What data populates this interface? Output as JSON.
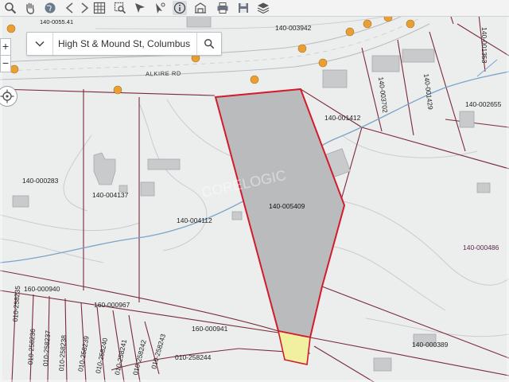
{
  "search": {
    "value": "High St & Mound St, Columbus",
    "placeholder": "High St & Mound St, Columbus"
  },
  "toolbar": {
    "tools": [
      {
        "name": "zoom-tool",
        "icon": "magnifier-icon"
      },
      {
        "name": "pan-tool",
        "icon": "hand-icon"
      },
      {
        "name": "full-extent-tool",
        "icon": "globe-icon"
      },
      {
        "name": "previous-extent-tool",
        "icon": "back-arrow-icon"
      },
      {
        "name": "next-extent-tool",
        "icon": "forward-arrow-icon"
      },
      {
        "name": "select-tool",
        "icon": "grid-select-icon"
      },
      {
        "name": "zoom-box-tool",
        "icon": "box-zoom-icon"
      },
      {
        "name": "locate-tool",
        "icon": "pointer-icon"
      },
      {
        "name": "measure-tool",
        "icon": "arrow-pointer-icon"
      },
      {
        "name": "identify-tool",
        "icon": "info-icon"
      },
      {
        "name": "property-tool",
        "icon": "building-icon"
      },
      {
        "name": "print-tool",
        "icon": "printer-icon"
      },
      {
        "name": "export-tool",
        "icon": "save-icon"
      },
      {
        "name": "layers-tool",
        "icon": "layers-icon"
      }
    ]
  },
  "zoom": {
    "in": "+",
    "out": "−"
  },
  "road": {
    "name": "ALKIRE RD"
  },
  "parcels": {
    "selected": "140-005409",
    "labels": [
      "140-003942",
      "140-000283",
      "140-004137",
      "140-004112",
      "140-001412",
      "140-002655",
      "140-003702",
      "140-001429",
      "140-001353",
      "140-000486",
      "160-000940",
      "160-000967",
      "160-000941",
      "140-000389",
      "010-258244",
      "010-258235",
      "010-258236",
      "010-258237",
      "010-258238",
      "010-258239",
      "010-258240",
      "010-258241",
      "010-258242",
      "010-258243",
      "140-0055.41"
    ]
  },
  "watermark": "CORELOGIC",
  "colors": {
    "selected_fill": "#b9bbbc",
    "selected_outline": "#d21b2b",
    "adjacent_fill": "#f0f0a0",
    "parcel_line": "#7a2a3a",
    "stream": "#7aa4c9",
    "marker": "#e8a032"
  }
}
